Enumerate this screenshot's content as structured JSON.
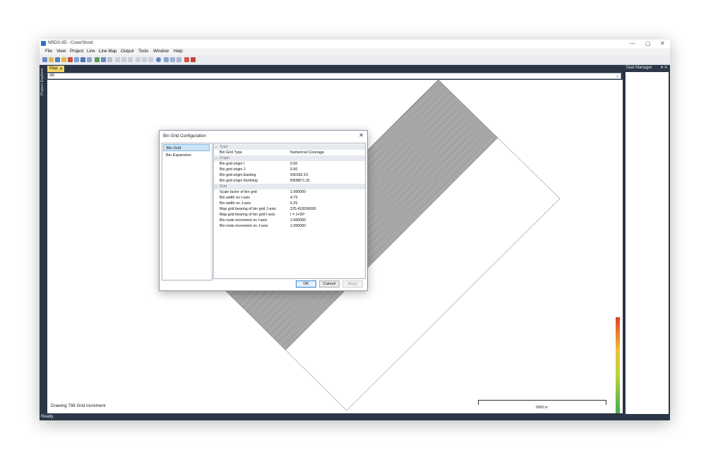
{
  "window": {
    "title": "NRDS-3D - CoverShoot",
    "controls": [
      "—",
      "▢",
      "✕"
    ]
  },
  "menu": [
    "File",
    "View",
    "Project",
    "Line",
    "Line Map",
    "Output",
    "Tools",
    "Window",
    "Help"
  ],
  "side_tab": "Project Explorer",
  "doc_tab": {
    "label": "Map",
    "close": "✕"
  },
  "filter": {
    "value": "All"
  },
  "map": {
    "status_text": "Drawing 798 Grid Increment",
    "scale_label": "5000 m"
  },
  "task_manager": {
    "title": "Task Manager",
    "controls": "▾ ✕"
  },
  "statusbar": {
    "text": "Ready"
  },
  "dialog": {
    "title": "Bin Grid Configuration",
    "close": "✕",
    "nav": [
      "Bin Grid",
      "Bin Expansion"
    ],
    "categories": {
      "type": "Type",
      "origin": "Origin",
      "grid": "Grid"
    },
    "rows": [
      {
        "key": "Bin Grid Type",
        "value": "Numerical Coverage"
      },
      {
        "key": "Bin grid origin I",
        "value": "0.50"
      },
      {
        "key": "Bin grid origin J",
        "value": "0.50"
      },
      {
        "key": "Bin grid origin Easting",
        "value": "930182.19"
      },
      {
        "key": "Bin grid origin Northing",
        "value": "8308871.31"
      },
      {
        "key": "Scale factor of bin grid",
        "value": "1.000000"
      },
      {
        "key": "Bin width on I-axis",
        "value": "4.75"
      },
      {
        "key": "Bin width on J-axis",
        "value": "6.25"
      },
      {
        "key": "Map grid bearing of bin grid J-axis",
        "value": "225.418206000"
      },
      {
        "key": "Map grid bearing of bin grid I-axis",
        "value": "I = J+90°"
      },
      {
        "key": "Bin node increment on I-axis",
        "value": "1.000000"
      },
      {
        "key": "Bin node increment on J-axis",
        "value": "1.000000"
      }
    ],
    "buttons": {
      "ok": "OK",
      "cancel": "Cancel",
      "apply": "Apply"
    }
  }
}
